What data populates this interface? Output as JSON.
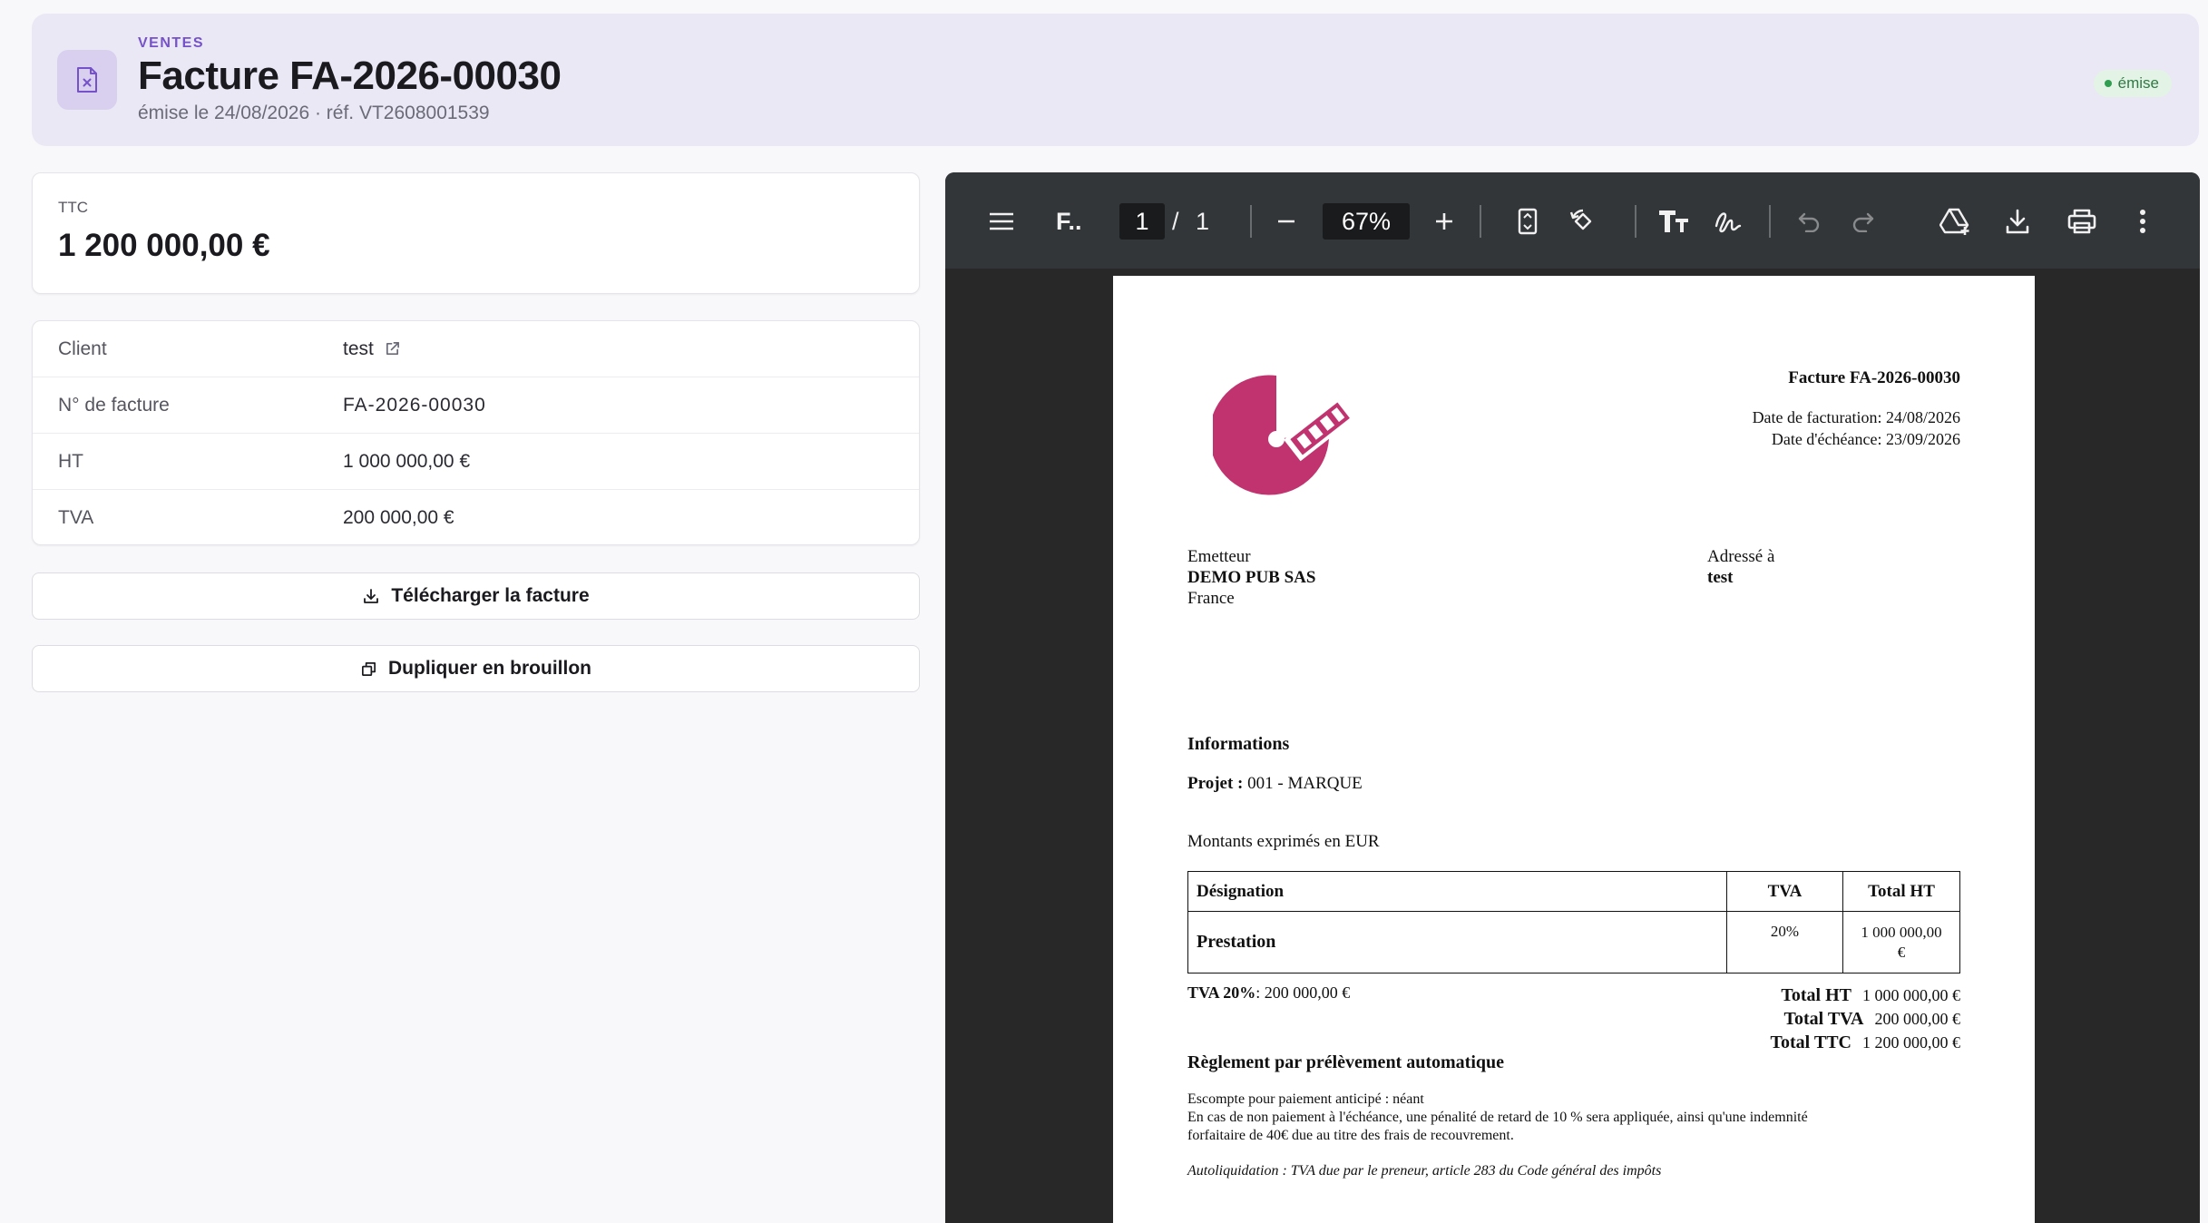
{
  "header": {
    "section": "VENTES",
    "title": "Facture FA-2026-00030",
    "subtitle": "émise le 24/08/2026 · réf. VT2608001539",
    "status": "émise",
    "icon": "invoice-x-icon"
  },
  "summary": {
    "ttc_label": "TTC",
    "ttc_value": "1 200 000,00 €"
  },
  "details": [
    {
      "label": "Client",
      "value": "test",
      "link": true
    },
    {
      "label": "N° de facture",
      "value": "FA-2026-00030"
    },
    {
      "label": "HT",
      "value": "1 000 000,00 €"
    },
    {
      "label": "TVA",
      "value": "200 000,00 €"
    }
  ],
  "actions": {
    "download": "Télécharger la facture",
    "duplicate": "Dupliquer en brouillon"
  },
  "viewer": {
    "doc_title": "F..",
    "page_current": "1",
    "page_sep": "/",
    "page_total": "1",
    "zoom": "67%"
  },
  "invoice": {
    "title": "Facture FA-2026-00030",
    "date_facturation": "Date de facturation: 24/08/2026",
    "date_echeance": "Date d'échéance: 23/09/2026",
    "emitter_label": "Emetteur",
    "emitter_name": "DEMO PUB SAS",
    "emitter_country": "France",
    "addressee_label": "Adressé à",
    "addressee_name": "test",
    "info_title": "Informations",
    "projet_label": "Projet :",
    "projet_value": " 001 - MARQUE",
    "montants": "Montants exprimés en EUR",
    "table_headers": [
      "Désignation",
      "TVA",
      "Total HT"
    ],
    "table_rows": [
      {
        "designation": "Prestation",
        "tva": "20%",
        "total_ht_1": "1 000 000,00",
        "total_ht_2": "€"
      }
    ],
    "tva_line_label": "TVA 20%",
    "tva_line_value": ": 200 000,00 €",
    "totals": [
      {
        "label": "Total HT",
        "value": "1 000 000,00 €"
      },
      {
        "label": "Total TVA",
        "value": "200 000,00 €"
      },
      {
        "label": "Total TTC",
        "value": "1 200 000,00 €"
      }
    ],
    "reglement": "Règlement par prélèvement automatique",
    "escompte": "Escompte pour paiement anticipé : néant",
    "penalite_1": "En cas de non paiement à l'échéance, une pénalité de retard de 10 % sera appliquée, ainsi qu'une indemnité",
    "penalite_2": "forfaitaire de 40€ due au titre des frais de recouvrement.",
    "autoliquidation": "Autoliquidation : TVA due par le preneur, article 283 du Code général des impôts"
  },
  "colors": {
    "accent": "#7552c9",
    "logo": "#c0336f",
    "status": "#2f7a44"
  }
}
